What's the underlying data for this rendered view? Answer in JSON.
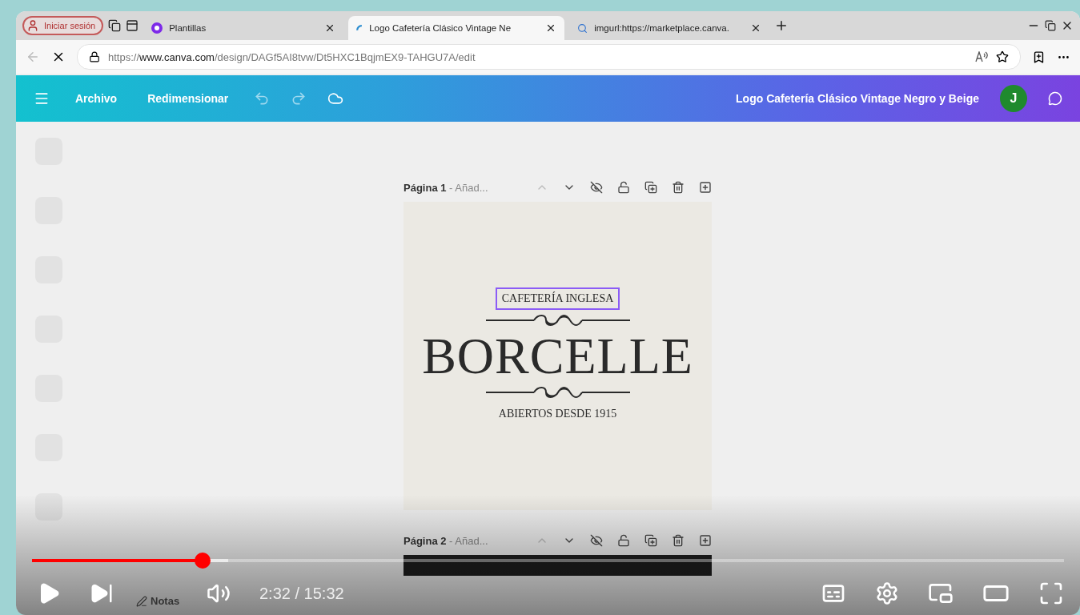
{
  "browser": {
    "profile_button": "Iniciar sesión",
    "tabs": [
      {
        "kind": "canva",
        "title": "Plantillas",
        "selected": false
      },
      {
        "kind": "loading",
        "title": "Logo Cafetería Clásico Vintage Ne",
        "selected": true
      },
      {
        "kind": "search",
        "title": "imgurl:https://marketplace.canva.",
        "selected": false
      }
    ],
    "url": "https://**www.canva.com**/design/DAGf5AI8tvw/Dt5HXC1BqjmEX9-TAHGU7A/edit"
  },
  "editor": {
    "menu": [
      "Archivo",
      "Redimensionar"
    ],
    "title": "Logo Cafetería Clásico Vintage Negro y Beige",
    "avatar": "J",
    "pages": [
      {
        "label": "**Página 1** - Añad..."
      },
      {
        "label": "**Página 2** - Añad..."
      }
    ],
    "design": [
      {
        "kind": "arc",
        "text": "CAFETERÍA INGLESA",
        "selected": true
      },
      {
        "kind": "ornament"
      },
      {
        "kind": "name",
        "text": "BORCELLE",
        "selected": false
      },
      {
        "kind": "ornament"
      },
      {
        "kind": "arc",
        "text": "ABIERTOS DESDE 1915",
        "selected": false
      }
    ],
    "footer": {
      "notes": "Notas"
    }
  },
  "video": {
    "progress": {
      "level": 0.165
    },
    "buffer": {
      "level": 0.19
    },
    "time": "2:32 / 15:32"
  }
}
